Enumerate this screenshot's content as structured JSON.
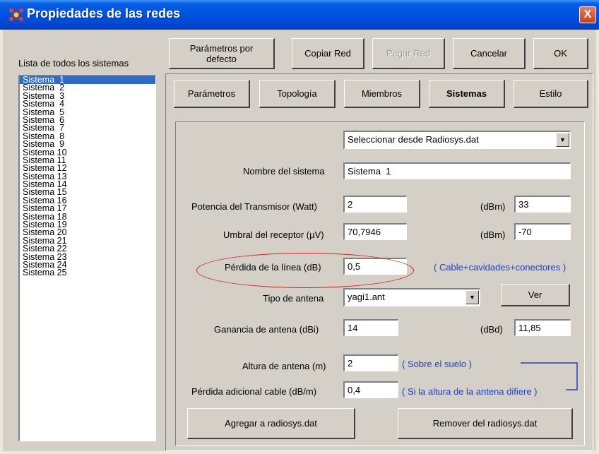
{
  "window": {
    "title": "Propiedades de las redes",
    "close_label": "X"
  },
  "sidebar": {
    "label": "Lista de todos los sistemas",
    "items": [
      "Sistema  1",
      "Sistema  2",
      "Sistema  3",
      "Sistema  4",
      "Sistema  5",
      "Sistema  6",
      "Sistema  7",
      "Sistema  8",
      "Sistema  9",
      "Sistema 10",
      "Sistema 11",
      "Sistema 12",
      "Sistema 13",
      "Sistema 14",
      "Sistema 15",
      "Sistema 16",
      "Sistema 17",
      "Sistema 18",
      "Sistema 19",
      "Sistema 20",
      "Sistema 21",
      "Sistema 22",
      "Sistema 23",
      "Sistema 24",
      "Sistema 25"
    ],
    "selected_index": 0
  },
  "toolbar": {
    "defaults_label": "Parámetros por defecto",
    "copy_label": "Copiar Red",
    "paste_label": "Pegar Red",
    "cancel_label": "Cancelar",
    "ok_label": "OK"
  },
  "tabs": {
    "parametros": "Parámetros",
    "topologia": "Topología",
    "miembros": "Miembros",
    "sistemas": "Sistemas",
    "estilo": "Estilo",
    "active": "sistemas"
  },
  "form": {
    "source_select": "Seleccionar desde Radiosys.dat",
    "system_name_label": "Nombre del sistema",
    "system_name_value": "Sistema  1",
    "tx_power_label": "Potencia del Transmisor (Watt)",
    "tx_power_value": "2",
    "tx_dbm_label": "(dBm)",
    "tx_dbm_value": "33",
    "rx_threshold_label": "Umbral del receptor (µV)",
    "rx_threshold_value": "70,7946",
    "rx_dbm_label": "(dBm)",
    "rx_dbm_value": "-70",
    "line_loss_label": "Pérdida de la línea (dB)",
    "line_loss_value": "0,5",
    "line_loss_note": "( Cable+cavidades+conectores )",
    "antenna_type_label": "Tipo de antena",
    "antenna_type_value": "yagi1.ant",
    "view_label": "Ver",
    "antenna_gain_label": "Ganancia de antena (dBi)",
    "antenna_gain_value": "14",
    "antenna_dbd_label": "(dBd)",
    "antenna_dbd_value": "11,85",
    "antenna_height_label": "Altura de antena (m)",
    "antenna_height_value": "2",
    "antenna_height_note": "( Sobre el suelo )",
    "extra_loss_label": "Pérdida adicional cable (dB/m)",
    "extra_loss_value": "0,4",
    "extra_loss_note": "( Si la altura de la antena difiere )",
    "add_label": "Agregar a radiosys.dat",
    "remove_label": "Remover del radiosys.dat"
  },
  "colors": {
    "title_bar": "#0055e5",
    "selection": "#316ac5",
    "note_text": "#1f3fc0",
    "annotation": "#d92020"
  }
}
